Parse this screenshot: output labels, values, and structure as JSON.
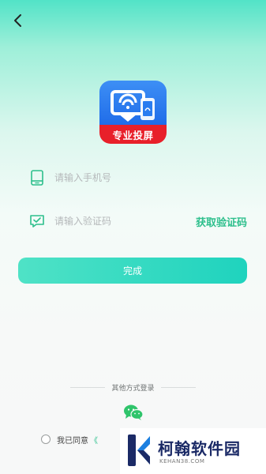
{
  "nav": {
    "back_icon": "chevron-left-icon"
  },
  "app": {
    "logo_caption": "专业投屏",
    "logo_icon": "cast-screen-icon",
    "brand_blue": "#2a7cf0",
    "brand_red": "#e8202a"
  },
  "form": {
    "phone": {
      "icon": "phone-icon",
      "placeholder": "请输入手机号",
      "value": ""
    },
    "code": {
      "icon": "message-check-icon",
      "placeholder": "请输入验证码",
      "value": "",
      "get_code_label": "获取验证码"
    },
    "submit_label": "完成"
  },
  "other_login": {
    "label": "其他方式登录",
    "wechat_icon": "wechat-icon"
  },
  "agreement": {
    "text": "我已同意",
    "link_text": "《",
    "checked": false
  },
  "watermark": {
    "title": "柯翰软件园",
    "url": "KEHAN38.COM"
  },
  "colors": {
    "accent": "#2dbf8c",
    "button": "#2fd8c0"
  }
}
